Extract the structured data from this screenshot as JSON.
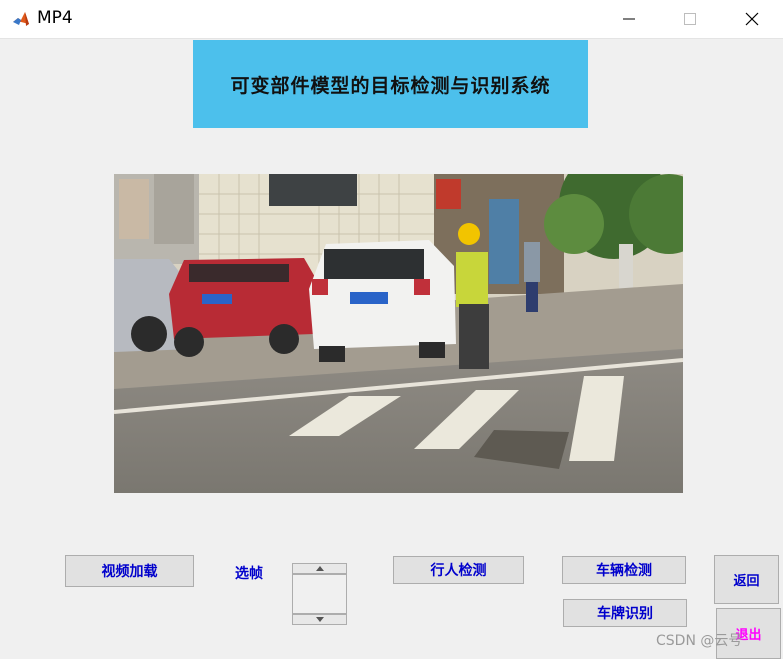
{
  "window": {
    "title": "MP4",
    "app_icon": "matlab-icon",
    "controls": [
      "minimize-icon",
      "maximize-icon",
      "close-icon"
    ]
  },
  "banner": {
    "title": "可变部件模型的目标检测与识别系统",
    "background": "#4cc0ec"
  },
  "video": {
    "content": "street scene: parked cars, worker in hard hat walking across crosswalk"
  },
  "controls": {
    "load_video": "视频加载",
    "frame_select_label": "选帧",
    "pedestrian_detect": "行人检测",
    "vehicle_detect": "车辆检测",
    "plate_recognize": "车牌识别",
    "back": "返回",
    "exit": "退出"
  },
  "colors": {
    "label_text": "#0000cc",
    "exit_text": "#ff00ff"
  },
  "watermark": "CSDN @云号"
}
